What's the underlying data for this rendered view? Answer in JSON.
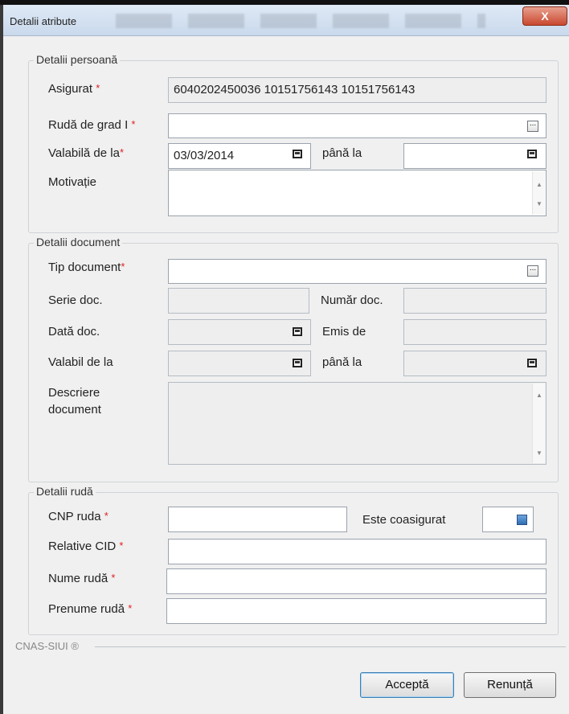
{
  "window": {
    "title": "Detalii atribute",
    "close_label": "X"
  },
  "required_mark": "*",
  "persona": {
    "legend": "Detalii persoană",
    "asigurat_label": "Asigurat",
    "asigurat_value": "6040202450036 10151756143 10151756143",
    "ruda_label": "Rudă de grad I",
    "ruda_value": "",
    "valabila_label": "Valabilă de la",
    "valabila_value": "03/03/2014",
    "pana_label": "până la",
    "pana_value": "",
    "motivatie_label": "Motivație",
    "motivatie_value": ""
  },
  "document": {
    "legend": "Detalii document",
    "tip_label": "Tip document",
    "tip_value": "",
    "serie_label": "Serie doc.",
    "numar_label": "Număr doc.",
    "data_label": "Dată doc.",
    "emis_label": "Emis de",
    "valabil_label": "Valabil de la",
    "pana_label": "până la",
    "descriere_label_1": "Descriere",
    "descriere_label_2": "document"
  },
  "ruda": {
    "legend": "Detalii rudă",
    "cnp_label": "CNP ruda",
    "coasigurat_label": "Este coasigurat",
    "coasigurat_checked": true,
    "cid_label": "Relative CID",
    "nume_label": "Nume rudă",
    "prenume_label": "Prenume rudă"
  },
  "footer": {
    "brand": "CNAS-SIUI ®",
    "accept_label": "Acceptă",
    "cancel_label": "Renunță"
  }
}
